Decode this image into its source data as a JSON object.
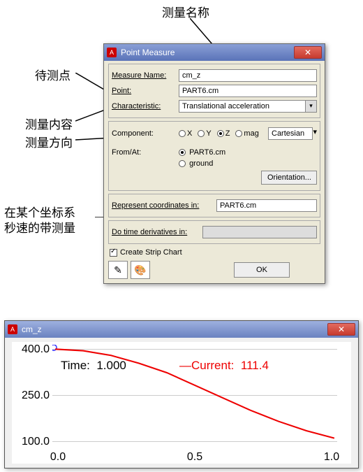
{
  "annotations": {
    "measure_name": "测量名称",
    "point_to_measure": "待测点",
    "characteristic": "测量内容",
    "component": "测量方向",
    "represent": "在某个坐标系\n秒速的带测量"
  },
  "dialog": {
    "title": "Point Measure",
    "labels": {
      "measure_name": "Measure Name:",
      "point": "Point:",
      "characteristic": "Characteristic:",
      "component": "Component:",
      "from_at": "From/At:",
      "represent": "Represent coordinates in:",
      "derivatives": "Do time derivatives in:",
      "create_chart": "Create Strip Chart",
      "orientation_btn": "Orientation...",
      "ok": "OK"
    },
    "values": {
      "measure_name": "cm_z",
      "point": "PART6.cm",
      "characteristic": "Translational acceleration",
      "component_options": {
        "x": "X",
        "y": "Y",
        "z": "Z",
        "mag": "mag"
      },
      "component_selected": "Z",
      "coord_system": "Cartesian",
      "from_at_options": {
        "part": "PART6.cm",
        "ground": "ground"
      },
      "from_at_selected": "PART6.cm",
      "represent": "PART6.cm",
      "derivatives": ""
    }
  },
  "chart": {
    "title": "cm_z",
    "time_label": "Time:",
    "time_value": "1.000",
    "current_label": "—Current:",
    "current_value": "111.4",
    "y_ticks": [
      "400.0",
      "250.0",
      "100.0"
    ],
    "x_ticks": [
      "0.0",
      "0.5",
      "1.0"
    ]
  },
  "chart_data": {
    "type": "line",
    "title": "cm_z",
    "xlabel": "Time",
    "ylabel": "",
    "xlim": [
      0.0,
      1.0
    ],
    "ylim": [
      100.0,
      400.0
    ],
    "series": [
      {
        "name": "Current",
        "color": "#e00000",
        "x": [
          0.0,
          0.1,
          0.2,
          0.3,
          0.4,
          0.5,
          0.6,
          0.7,
          0.8,
          0.9,
          1.0
        ],
        "values": [
          395,
          390,
          375,
          350,
          320,
          280,
          240,
          200,
          165,
          135,
          111.4
        ]
      }
    ]
  }
}
